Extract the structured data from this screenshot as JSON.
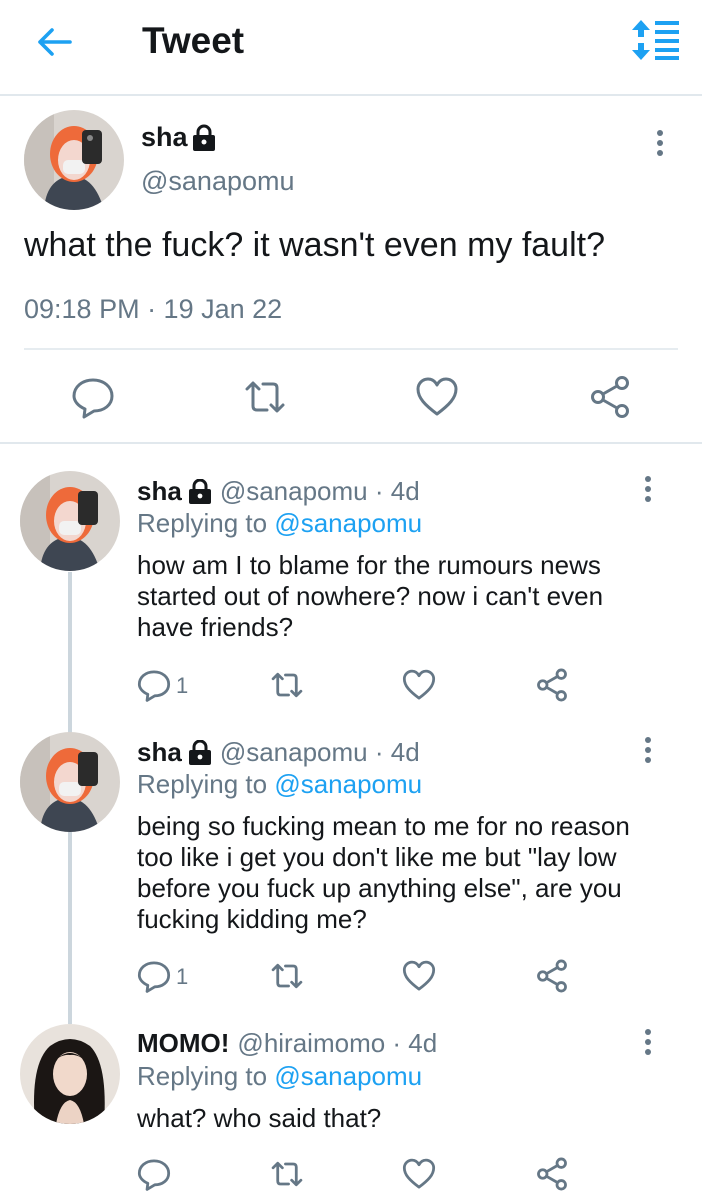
{
  "header": {
    "title": "Tweet",
    "back_icon": "arrow-left-icon",
    "sort_icon": "sort-icon",
    "accent_color": "#1da1f2"
  },
  "main_tweet": {
    "name": "sha",
    "handle": "@sanapomu",
    "text": "what the fuck? it wasn't even my fault?",
    "timestamp": "09:18 PM · 19 Jan 22",
    "protected_icon": "lock-icon",
    "actions": [
      "reply-icon",
      "retweet-icon",
      "like-icon",
      "share-icon"
    ]
  },
  "replies": [
    {
      "name": "sha",
      "handle": "@sanapomu · 4d",
      "replying_prefix": "Replying to",
      "replying_to": "@sanapomu",
      "text": "how am I to blame for the rumours news started out of nowhere? now i can't even have friends?",
      "reply_count": "1",
      "protected": true
    },
    {
      "name": "sha",
      "handle": "@sanapomu · 4d",
      "replying_prefix": "Replying to",
      "replying_to": "@sanapomu",
      "text": "being so fucking mean to me for no reason too like i get you don't like me but \"lay low before you fuck up anything else\", are you fucking kidding me?",
      "reply_count": "1",
      "protected": true
    },
    {
      "name": "MOMO!",
      "handle": "@hiraimomo · 4d",
      "replying_prefix": "Replying to",
      "replying_to": "@sanapomu",
      "text": "what? who said that?",
      "reply_count": "",
      "protected": false
    }
  ]
}
